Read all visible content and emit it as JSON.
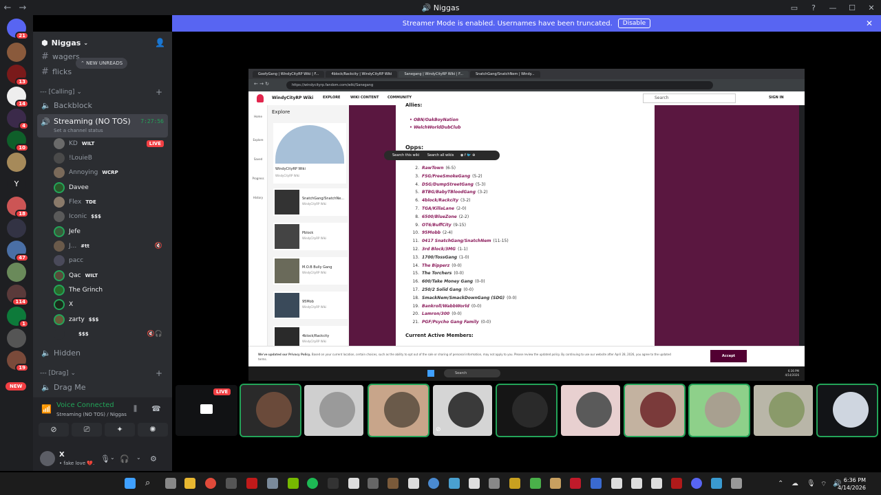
{
  "window": {
    "title": "Niggas"
  },
  "banner": {
    "text": "Streamer Mode is enabled. Usernames have been truncated.",
    "disable_label": "Disable"
  },
  "guilds": [
    {
      "badge": "21"
    },
    {
      "badge": ""
    },
    {
      "badge": "13"
    },
    {
      "badge": "14"
    },
    {
      "badge": "4"
    },
    {
      "badge": "10"
    },
    {
      "badge": ""
    },
    {
      "badge": ""
    },
    {
      "badge": "18"
    },
    {
      "badge": ""
    },
    {
      "badge": "47"
    },
    {
      "badge": ""
    },
    {
      "badge": "114"
    },
    {
      "badge": "1"
    },
    {
      "badge": ""
    },
    {
      "badge": "19"
    }
  ],
  "guild_letter": "Y",
  "new_label": "NEW",
  "server": {
    "name": "Niggas"
  },
  "channels": {
    "new_unreads": "NEW UNREADS",
    "wagers": "wagers",
    "flicks": "flicks",
    "calling_category": "--- [Calling]",
    "backblock": "Backblock",
    "streaming": {
      "name": "Streaming (NO TOS)",
      "status": "Set a channel status",
      "timer": "7:27:56"
    },
    "hidden": "Hidden",
    "drag_category": "--- [Drag]",
    "drag_me": "Drag Me"
  },
  "voice_users": [
    {
      "name": "KD",
      "tag": "WILT",
      "live": "LIVE"
    },
    {
      "name": "!LouieB",
      "tag": ""
    },
    {
      "name": "Annoying",
      "tag": "WCRP"
    },
    {
      "name": "Davee",
      "tag": ""
    },
    {
      "name": "Flex",
      "tag": "TDE"
    },
    {
      "name": "Iconic",
      "tag": "$$$"
    },
    {
      "name": "Jefe",
      "tag": ""
    },
    {
      "name": "J...",
      "tag": "#tt"
    },
    {
      "name": "pacc",
      "tag": ""
    },
    {
      "name": "Qac",
      "tag": "WILT"
    },
    {
      "name": "The Grinch",
      "tag": ""
    },
    {
      "name": "X",
      "tag": ""
    },
    {
      "name": "zarty",
      "tag": "$$$"
    },
    {
      "name": "",
      "tag": "$$$"
    }
  ],
  "voice_panel": {
    "title": "Voice Connected",
    "sub": "Streaming (NO TOS) / Niggas"
  },
  "me": {
    "name": "X",
    "status": "• fake love 💔."
  },
  "stream": {
    "live": "LIVE",
    "browser": {
      "tabs": [
        "GoofyGang | WindyCityRP Wiki | F...",
        "4block/Rackcity | WindyCityRP Wiki",
        "Sanegang | WindyCityRP Wiki | F...",
        "SnatchGang/SnatchNem | Windy..."
      ],
      "url": "https://windycityrp.fandom.com/wiki/Sanegang",
      "site_name": "WindyCityRP Wiki",
      "nav": [
        "EXPLORE",
        "WIKI CONTENT",
        "COMMUNITY"
      ],
      "search": "Search",
      "sign_in": "SIGN IN",
      "left_nav": [
        "Home",
        "Explore",
        "Saved",
        "Progress",
        "History"
      ],
      "explore_title": "Explore",
      "hero": {
        "title": "WindyCityRP Wiki",
        "sub": "WindyCityRP Wiki"
      },
      "cards": [
        {
          "title": "SnatchGang/SnatchNe...",
          "sub": "WindyCityRP Wiki"
        },
        {
          "title": "Pblock",
          "sub": "WindyCityRP Wiki"
        },
        {
          "title": "M.O.B Bully Gang",
          "sub": "WindyCityRP Wiki"
        },
        {
          "title": "95Mob",
          "sub": "WindyCityRP Wiki"
        },
        {
          "title": "4block/Rackcity",
          "sub": "WindyCityRP Wiki"
        }
      ],
      "allies_heading": "Allies:",
      "allies": [
        "OBN/OakBoyNation",
        "WelchWorldDubClub"
      ],
      "opps_heading": "Opps:",
      "search_this": "Search this wiki",
      "search_all": "Search all wikis",
      "opps": [
        {
          "n": "2.",
          "g": "RawTown",
          "s": "(6-5)"
        },
        {
          "n": "3.",
          "g": "FSG/FreeSmokeGang",
          "s": "(5-2)"
        },
        {
          "n": "4.",
          "g": "DSG/DumpStreetGang",
          "s": "(5-3)"
        },
        {
          "n": "5.",
          "g": "BTBG/BabyTBloodGang",
          "s": "(3-2)"
        },
        {
          "n": "6.",
          "g": "4block/Rackcity",
          "s": "(3-2)"
        },
        {
          "n": "7.",
          "g": "TGA/KillaLane",
          "s": "(2-0)"
        },
        {
          "n": "8.",
          "g": "6500/BlueZone",
          "s": "(2-2)"
        },
        {
          "n": "9.",
          "g": "OT6/BuffCity",
          "s": "(9-15)"
        },
        {
          "n": "10.",
          "g": "95Mobb",
          "s": "(2-4)"
        },
        {
          "n": "11.",
          "g": "0417 SnatchGang/SnatchNem",
          "s": "(11-15)"
        },
        {
          "n": "12.",
          "g": "3rd Block/3MG",
          "s": "(1-1)"
        },
        {
          "n": "13.",
          "g": "1700/TossGang",
          "s": "(1-0)",
          "plain": true
        },
        {
          "n": "14.",
          "g": "The Bipperz",
          "s": "(0-0)"
        },
        {
          "n": "15.",
          "g": "The Torchers",
          "s": "(0-0)",
          "plain": true
        },
        {
          "n": "16.",
          "g": "600/Take Money Gang",
          "s": "(0-0)",
          "plain": true
        },
        {
          "n": "17.",
          "g": "250/2 Solid Gang",
          "s": "(0-0)",
          "plain": true
        },
        {
          "n": "18.",
          "g": "SmackNem/SmackDownGang (SDG)",
          "s": "(0-0)",
          "plain": true
        },
        {
          "n": "19.",
          "g": "Bankroll/WabbWorld",
          "s": "(0-0)"
        },
        {
          "n": "20.",
          "g": "Lamron/300",
          "s": "(0-0)"
        },
        {
          "n": "21.",
          "g": "PGF/Psycho Gang Family",
          "s": "(0-0)"
        }
      ],
      "current_members": "Current Active Members:",
      "cookie_bold": "We've updated our Privacy Policy.",
      "cookie_text": "Based on your current location, certain choices, such as the ability to opt out of the sale or sharing of personal information, may not apply to you. Please review the updated policy. By continuing to use our website after April 28, 2026, you agree to the updated terms.",
      "accept": "Accept",
      "task_search": "Search",
      "task_time": "6:36 PM",
      "task_date": "4/14/2026"
    }
  },
  "taskbar": {
    "time": "6:36 PM",
    "date": "4/14/2026"
  }
}
